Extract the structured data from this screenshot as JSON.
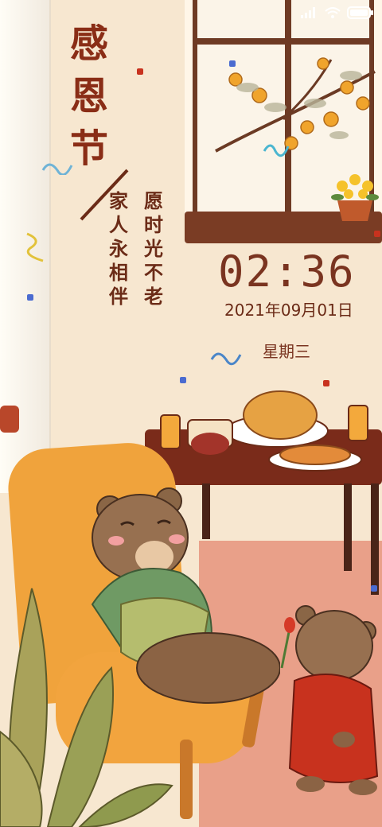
{
  "status_bar": {
    "icons": [
      "signal-icon",
      "wifi-icon",
      "battery-icon"
    ]
  },
  "poster": {
    "title_chars": [
      "感",
      "恩",
      "节"
    ],
    "subtitle_col1": [
      "家",
      "人",
      "永",
      "相",
      "伴"
    ],
    "subtitle_col2": [
      "愿",
      "时",
      "光",
      "不",
      "老"
    ]
  },
  "lockscreen": {
    "time": "02:36",
    "date": "2021年09月01日",
    "weekday": "星期三"
  },
  "colors": {
    "title": "#8a2d16",
    "clock": "#7a3420",
    "background": "#f7e7d0"
  }
}
